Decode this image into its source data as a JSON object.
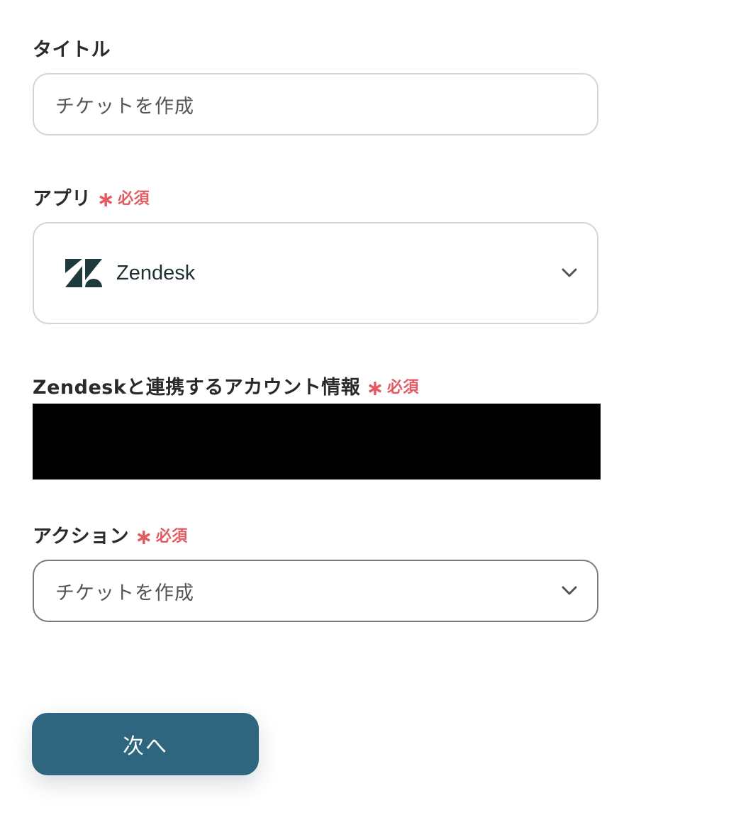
{
  "title_section": {
    "label": "タイトル",
    "value": "チケットを作成"
  },
  "app_section": {
    "label": "アプリ",
    "required_star": "∗",
    "required_text": "必須",
    "selected_app": "Zendesk",
    "app_icon": "zendesk-logo",
    "dropdown_icon": "chevron-down-icon"
  },
  "account_section": {
    "label": "Zendeskと連携するアカウント情報",
    "required_star": "∗",
    "required_text": "必須"
  },
  "action_section": {
    "label": "アクション",
    "required_star": "∗",
    "required_text": "必須",
    "selected_action": "チケットを作成",
    "dropdown_icon": "chevron-down-icon"
  },
  "footer": {
    "next_label": "次へ"
  },
  "colors": {
    "required": "#e25b62",
    "button": "#2e6680",
    "zendesk_logo": "#1f3a3d"
  }
}
